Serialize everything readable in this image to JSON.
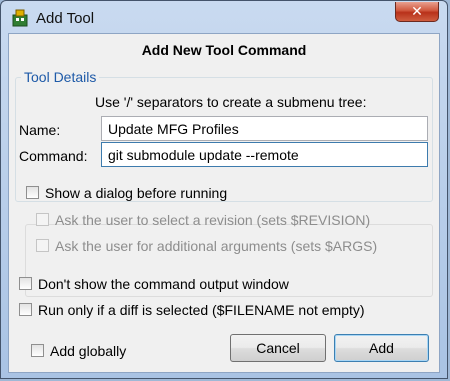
{
  "window": {
    "title": "Add Tool",
    "close_glyph": "✕"
  },
  "dialog": {
    "heading": "Add New Tool Command",
    "group_title": "Tool Details",
    "hint": "Use '/' separators to create a submenu tree:",
    "name_label": "Name:",
    "name_value": "Update MFG Profiles",
    "command_label": "Command:",
    "command_value": "git submodule update --remote"
  },
  "options": {
    "show_dialog": "Show a dialog before running",
    "ask_revision": "Ask the user to select a revision (sets $REVISION)",
    "ask_args": "Ask the user for additional arguments (sets $ARGS)",
    "no_output": "Don't show the command output window",
    "diff_only": "Run only if a diff is selected ($FILENAME not empty)",
    "add_globally": "Add globally"
  },
  "buttons": {
    "cancel": "Cancel",
    "add": "Add"
  },
  "colors": {
    "group_title": "#1e5aa8",
    "close_button": "#c8442a",
    "default_border": "#3c7fb1"
  }
}
